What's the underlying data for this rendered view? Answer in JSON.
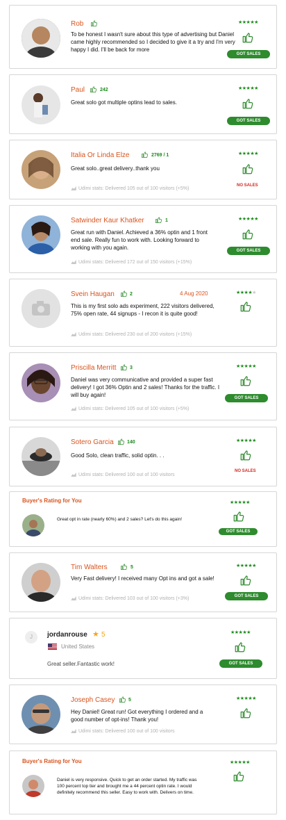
{
  "colors": {
    "accent": "#d9541e",
    "green": "#2e8b2e",
    "red": "#d0291f",
    "muted": "#b0b0b0"
  },
  "reviews": [
    {
      "name": "Rob",
      "count": "",
      "text": "To be honest I wasn't sure about this type of advertising but Daniel came highly recommended so I decided to give it a try and I'm very happy I did. I'll be back for more",
      "stats": "",
      "stars": "★★★★★",
      "badge": "GOT SALES"
    },
    {
      "name": "Paul",
      "count": "242",
      "text": "Great solo got multiple optins lead to sales.",
      "stats": "",
      "stars": "★★★★★",
      "badge": "GOT SALES"
    },
    {
      "name": "Italia Or Linda Elze",
      "count": "2769 / 1",
      "text": "Great solo..great delivery..thank you",
      "stats": "Udimi stats: Delivered 105 out of 100 visitors (+5%)",
      "stars": "★★★★★",
      "badge": "NO SALES"
    },
    {
      "name": "Satwinder Kaur Khatker",
      "count": "1",
      "text": "Great run with Daniel. Achieved a 36% optin and 1 front end sale. Really fun to work with. Looking forward to working with you again.",
      "stats": "Udimi stats: Delivered 172 out of 150 visitors (+15%)",
      "stars": "★★★★★",
      "badge": "GOT SALES"
    },
    {
      "name": "Svein Haugan",
      "count": "2",
      "date": "4 Aug 2020",
      "text": "This is my first solo ads experiment, 222 visitors delivered, 75% open rate, 44 signups - I recon it is quite good!",
      "stats": "Udimi stats: Delivered 230 out of 200 visitors (+15%)",
      "stars": "★★★★",
      "star_off": "★",
      "badge": ""
    },
    {
      "name": "Priscilla Merritt",
      "count": "3",
      "text": "Daniel was very communicative and provided a super fast delivery! I got 36% Optin and 2 sales! Thanks for the traffic. I will buy again!",
      "stats": "Udimi stats: Delivered 105 out of 100 visitors (+5%)",
      "stars": "★★★★★",
      "badge": "GOT SALES"
    },
    {
      "name": "Sotero Garcia",
      "count": "140",
      "text": "Good Solo, clean traffic, solid optin. . .",
      "stats": "Udimi stats: Delivered 100 out of 100 visitors",
      "stars": "★★★★★",
      "badge": "NO SALES"
    },
    {
      "section": "Buyer's Rating for You",
      "text": "Great opt in rate (nearly 60%) and 2 sales? Let's do this again!",
      "stars": "★★★★★",
      "badge": "GOT SALES"
    },
    {
      "name": "Tim Walters",
      "count": "5",
      "text": "Very Fast delivery! I received many Opt ins and got a sale!",
      "stats": "Udimi stats: Delivered 103 out of 100 visitors (+3%)",
      "stars": "★★★★★",
      "badge": "GOT SALES"
    },
    {
      "name": "jordanrouse",
      "rating": "5",
      "country": "United States",
      "initial": "J",
      "text": "Great seller.Fantastic work!",
      "stars": "★★★★★",
      "badge": "GOT SALES"
    },
    {
      "name": "Joseph Casey",
      "count": "5",
      "text": "Hey Daniel! Great run! Got everything I ordered and a good number of opt-ins! Thank you!",
      "stats": "Udimi stats: Delivered 100 out of 100 visitors",
      "stars": "★★★★★",
      "badge": ""
    },
    {
      "section": "Buyer's Rating for You",
      "text": "Daniel is very responsive. Quick to get an order started. My traffic was 100 percent top tier and brought me a 44 percent optin rate. I would definitely recommend this seller. Easy to work with. Delivers on time.",
      "stars": "★★★★★",
      "badge": ""
    }
  ]
}
